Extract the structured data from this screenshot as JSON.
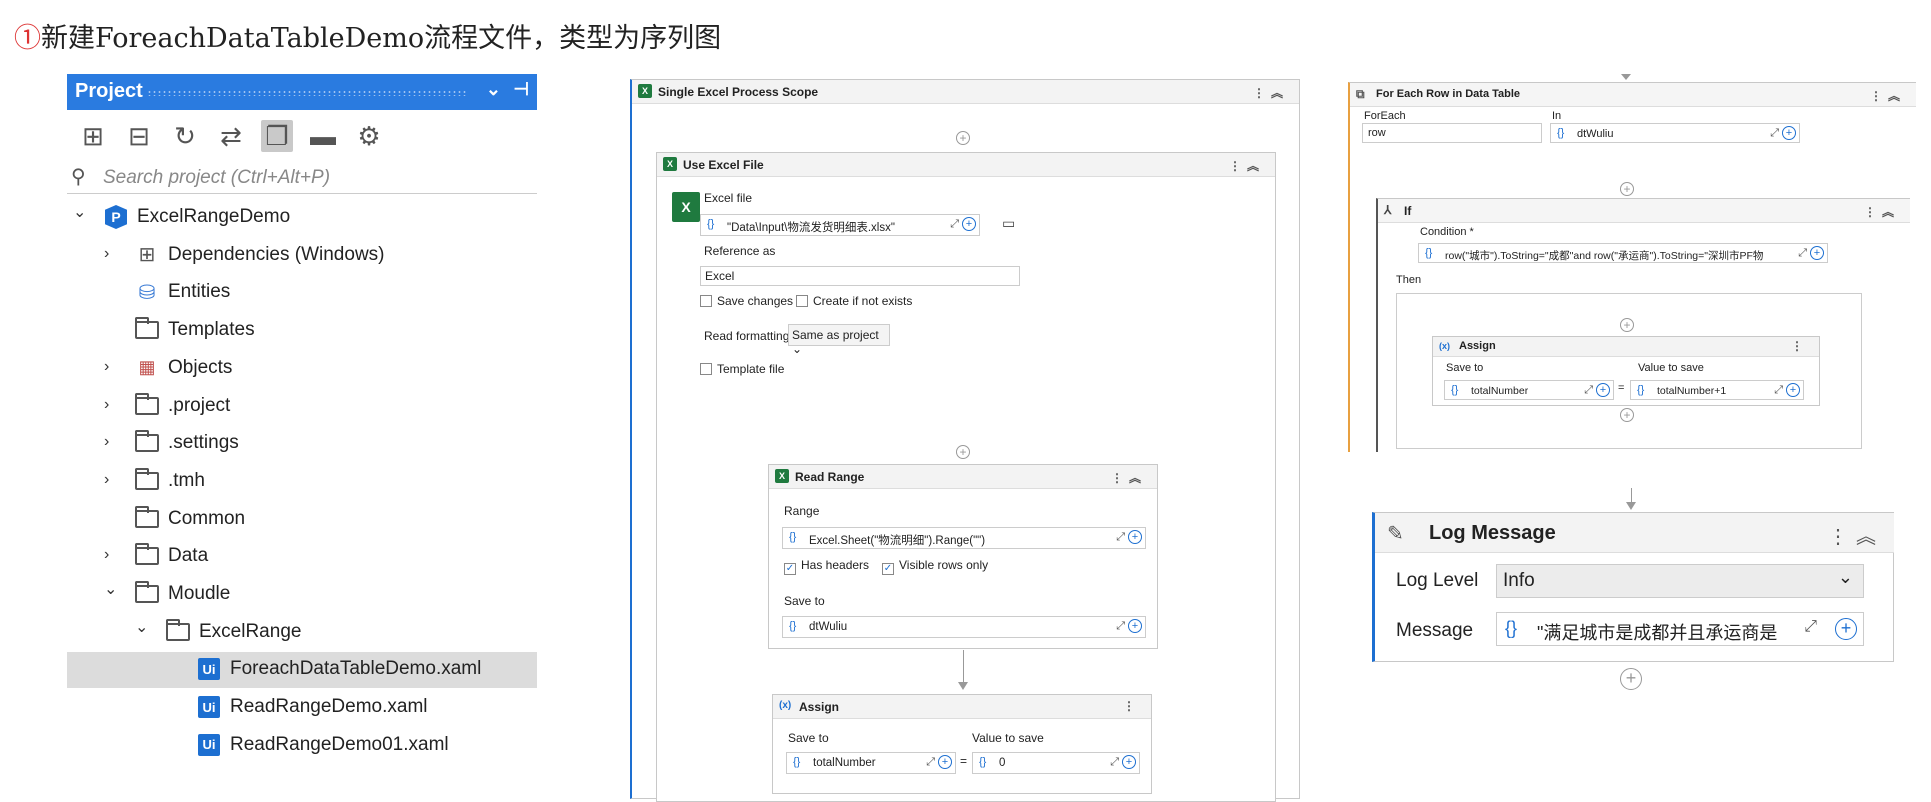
{
  "header": {
    "num": "①",
    "text": "新建ForeachDataTableDemo流程文件，类型为序列图"
  },
  "project": {
    "title": "Project",
    "search_placeholder": "Search project (Ctrl+Alt+P)",
    "tree": [
      {
        "label": "ExcelRangeDemo",
        "icon": "project-icon"
      },
      {
        "label": "Dependencies (Windows)",
        "icon": "dependencies-icon"
      },
      {
        "label": "Entities",
        "icon": "entities-icon"
      },
      {
        "label": "Templates",
        "icon": "folder-icon"
      },
      {
        "label": "Objects",
        "icon": "objects-icon"
      },
      {
        "label": ".project",
        "icon": "folder-icon"
      },
      {
        "label": ".settings",
        "icon": "folder-icon"
      },
      {
        "label": ".tmh",
        "icon": "folder-icon"
      },
      {
        "label": "Common",
        "icon": "folder-icon"
      },
      {
        "label": "Data",
        "icon": "folder-icon"
      },
      {
        "label": "Moudle",
        "icon": "folder-icon"
      },
      {
        "label": "ExcelRange",
        "icon": "folder-icon"
      },
      {
        "label": "ForeachDataTableDemo.xaml",
        "icon": "xaml-icon"
      },
      {
        "label": "ReadRangeDemo.xaml",
        "icon": "xaml-icon"
      },
      {
        "label": "ReadRangeDemo01.xaml",
        "icon": "xaml-icon"
      }
    ]
  },
  "workflow": {
    "scope_title": "Single Excel Process Scope",
    "use_excel": {
      "title": "Use Excel File",
      "excel_file_label": "Excel file",
      "excel_file_value": "\"Data\\Input\\物流发货明细表.xlsx\"",
      "reference_label": "Reference as",
      "reference_value": "Excel",
      "save_changes": "Save changes",
      "create_if_not_exists": "Create if not exists",
      "read_formatting_label": "Read formatting",
      "read_formatting_value": "Same as project",
      "template_file": "Template file"
    },
    "read_range": {
      "title": "Read Range",
      "range_label": "Range",
      "range_value": "Excel.Sheet(\"物流明细\").Range(\"\")",
      "has_headers": "Has headers",
      "visible_rows": "Visible rows only",
      "save_to_label": "Save to",
      "save_to_value": "dtWuliu"
    },
    "assign1": {
      "title": "Assign",
      "save_to_label": "Save to",
      "value_label": "Value to save",
      "save_to_value": "totalNumber",
      "value": "0"
    },
    "foreach": {
      "title": "For Each Row in Data Table",
      "foreach_label": "ForEach",
      "in_label": "In",
      "foreach_value": "row",
      "in_value": "dtWuliu"
    },
    "if": {
      "title": "If",
      "condition_label": "Condition *",
      "condition_value": "row(\"城市\").ToString=\"成都\"and row(\"承运商\").ToString=\"深圳市PF物",
      "then_label": "Then"
    },
    "assign2": {
      "title": "Assign",
      "save_to_label": "Save to",
      "value_label": "Value to save",
      "save_to_value": "totalNumber",
      "value": "totalNumber+1"
    },
    "log": {
      "title": "Log Message",
      "level_label": "Log Level",
      "level_value": "Info",
      "message_label": "Message",
      "message_value": "\"满足城市是成都并且承运商是深"
    }
  },
  "colors": {
    "accent": "#2a7be0",
    "excel_green": "#1f7a3f",
    "orange": "#e8a040"
  }
}
